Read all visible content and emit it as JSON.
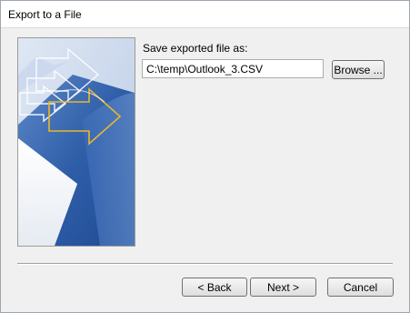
{
  "window": {
    "title": "Export to a File"
  },
  "form": {
    "save_label": "Save exported file as:",
    "path_value": "C:\\temp\\Outlook_3.CSV",
    "browse_label": "Browse ..."
  },
  "footer": {
    "back_label": "< Back",
    "next_label": "Next >",
    "cancel_label": "Cancel"
  },
  "banner": {
    "icon": "export-wizard-arrow-graphic"
  },
  "colors": {
    "dialog_bg": "#f0f0f0",
    "banner_blue": "#2f5ea8",
    "arrow_gold": "#e6b92b"
  }
}
